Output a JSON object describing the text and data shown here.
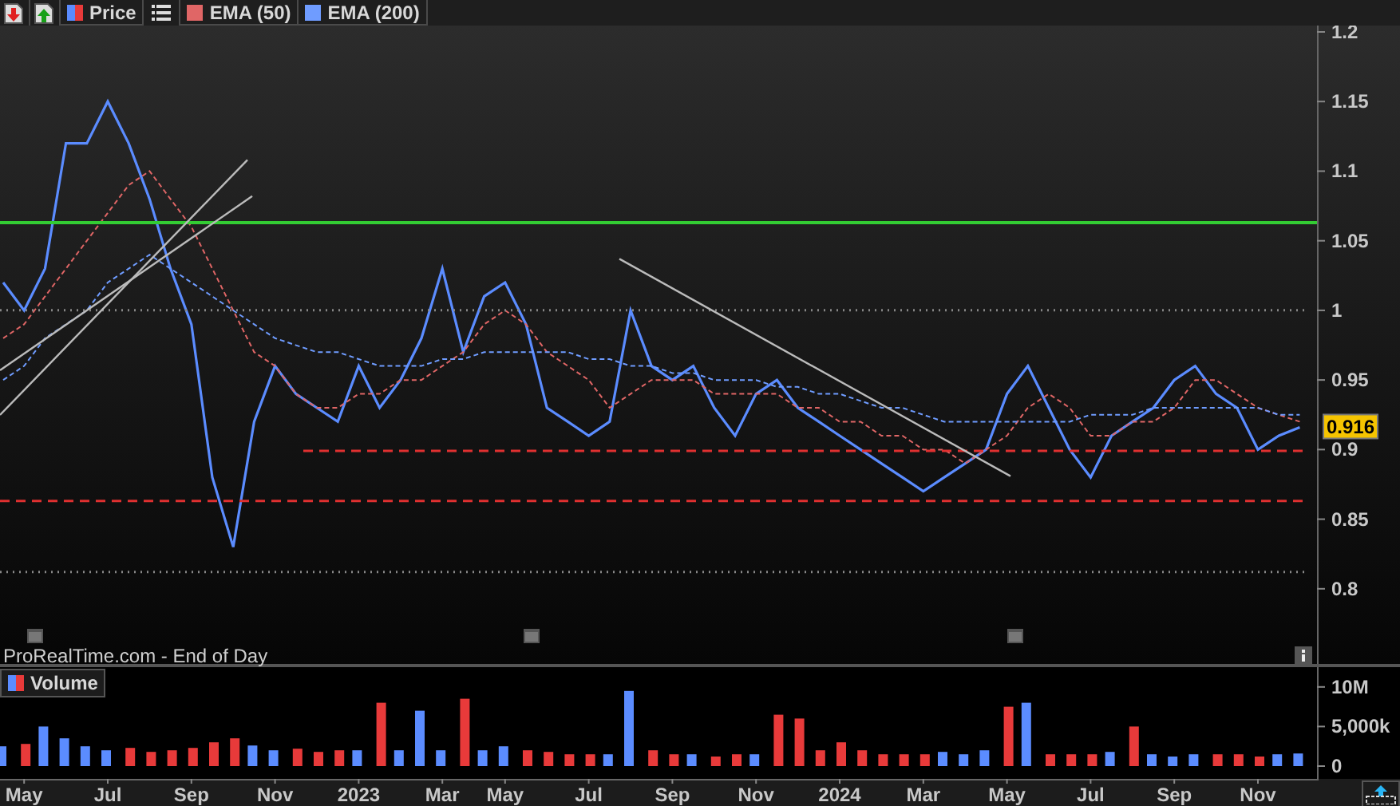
{
  "price_panel": {
    "source_label": "ProRealTime.com - End of Day",
    "chart_data": {
      "type": "line",
      "categories": [
        null,
        null,
        null,
        null,
        null,
        null,
        null,
        null,
        null,
        null,
        null,
        null,
        null,
        null,
        null,
        null,
        null,
        null,
        null,
        null,
        null,
        null,
        null,
        null,
        null,
        null,
        null,
        null,
        null,
        null,
        null,
        null,
        null,
        null,
        null,
        null,
        null,
        null,
        null,
        null,
        null,
        null,
        null,
        null,
        null,
        null,
        null,
        null,
        null,
        null,
        null,
        null,
        null,
        null,
        null,
        null,
        null,
        null,
        null,
        null,
        null,
        null,
        null
      ],
      "series": [
        {
          "name": "Price",
          "color": "#5b8cff",
          "values": [
            1.02,
            1.0,
            1.03,
            1.12,
            1.12,
            1.15,
            1.12,
            1.08,
            1.03,
            0.99,
            0.88,
            0.83,
            0.92,
            0.96,
            0.94,
            0.93,
            0.92,
            0.96,
            0.93,
            0.95,
            0.98,
            1.03,
            0.97,
            1.01,
            1.02,
            0.99,
            0.93,
            0.92,
            0.91,
            0.92,
            1.0,
            0.96,
            0.95,
            0.96,
            0.93,
            0.91,
            0.94,
            0.95,
            0.93,
            0.92,
            0.91,
            0.9,
            0.89,
            0.88,
            0.87,
            0.88,
            0.89,
            0.9,
            0.94,
            0.96,
            0.93,
            0.9,
            0.88,
            0.91,
            0.92,
            0.93,
            0.95,
            0.96,
            0.94,
            0.93,
            0.9,
            0.91,
            0.916
          ]
        },
        {
          "name": "EMA (50)",
          "color": "#e06666",
          "line_style": "dashed",
          "values": [
            0.98,
            0.99,
            1.01,
            1.03,
            1.05,
            1.07,
            1.09,
            1.1,
            1.08,
            1.06,
            1.03,
            1.0,
            0.97,
            0.96,
            0.94,
            0.93,
            0.93,
            0.94,
            0.94,
            0.95,
            0.95,
            0.96,
            0.97,
            0.99,
            1.0,
            0.99,
            0.97,
            0.96,
            0.95,
            0.93,
            0.94,
            0.95,
            0.95,
            0.95,
            0.94,
            0.94,
            0.94,
            0.94,
            0.93,
            0.93,
            0.92,
            0.92,
            0.91,
            0.91,
            0.9,
            0.9,
            0.89,
            0.9,
            0.91,
            0.93,
            0.94,
            0.93,
            0.91,
            0.91,
            0.92,
            0.92,
            0.93,
            0.95,
            0.95,
            0.94,
            0.93,
            0.925,
            0.92
          ]
        },
        {
          "name": "EMA (200)",
          "color": "#6f9cff",
          "line_style": "dashed",
          "values": [
            0.95,
            0.96,
            0.98,
            0.99,
            1.0,
            1.02,
            1.03,
            1.04,
            1.03,
            1.02,
            1.01,
            1.0,
            0.99,
            0.98,
            0.975,
            0.97,
            0.97,
            0.965,
            0.96,
            0.96,
            0.96,
            0.965,
            0.965,
            0.97,
            0.97,
            0.97,
            0.97,
            0.97,
            0.965,
            0.965,
            0.96,
            0.96,
            0.955,
            0.955,
            0.95,
            0.95,
            0.95,
            0.945,
            0.945,
            0.94,
            0.94,
            0.935,
            0.93,
            0.93,
            0.925,
            0.92,
            0.92,
            0.92,
            0.92,
            0.92,
            0.92,
            0.92,
            0.925,
            0.925,
            0.925,
            0.93,
            0.93,
            0.93,
            0.93,
            0.93,
            0.93,
            0.925,
            0.925
          ]
        }
      ],
      "ylim": [
        0.746,
        1.2046
      ],
      "yticks": [
        0.8,
        0.85,
        0.9,
        0.95,
        1,
        1.05,
        1.1,
        1.15,
        1.2
      ],
      "annotations": [
        "0.916"
      ]
    }
  },
  "volume_panel": {
    "chart_data": {
      "type": "bar",
      "title": "Volume",
      "stacked": false,
      "categories": [
        null,
        "May",
        null,
        null,
        null,
        "Jul",
        null,
        null,
        null,
        "Sep",
        null,
        null,
        null,
        "Nov",
        null,
        null,
        null,
        "2023",
        null,
        null,
        null,
        "Mar",
        null,
        null,
        "May",
        null,
        null,
        null,
        "Jul",
        null,
        null,
        null,
        "Sep",
        null,
        null,
        null,
        "Nov",
        null,
        null,
        null,
        "2024",
        null,
        null,
        null,
        "Mar",
        null,
        null,
        null,
        "May",
        null,
        null,
        null,
        "Jul",
        null,
        null,
        null,
        "Sep",
        null,
        null,
        null,
        "Nov",
        null,
        null
      ],
      "series": [
        {
          "color": "#5b8cff",
          "values": [
            2500000,
            null,
            5000000,
            3500000,
            2500000,
            2000000,
            null,
            null,
            null,
            null,
            null,
            null,
            2600000,
            2000000,
            null,
            null,
            null,
            2000000,
            null,
            2000000,
            7000000,
            2000000,
            null,
            2000000,
            2500000,
            null,
            null,
            null,
            null,
            1500000,
            9500000,
            null,
            null,
            1500000,
            null,
            null,
            1500000,
            null,
            null,
            null,
            null,
            null,
            null,
            null,
            null,
            1800000,
            1500000,
            2000000,
            null,
            8000000,
            null,
            null,
            null,
            1800000,
            null,
            1500000,
            1200000,
            1500000,
            null,
            null,
            null,
            1500000,
            1600000
          ]
        },
        {
          "color": "#e83a3a",
          "values": [
            null,
            2800000,
            null,
            null,
            null,
            null,
            2300000,
            1800000,
            2000000,
            2300000,
            3000000,
            3500000,
            null,
            null,
            2200000,
            1800000,
            2000000,
            null,
            8000000,
            null,
            null,
            null,
            8500000,
            null,
            null,
            2000000,
            1800000,
            1500000,
            1500000,
            null,
            null,
            2000000,
            1500000,
            null,
            1200000,
            1500000,
            null,
            6500000,
            6000000,
            2000000,
            3000000,
            2000000,
            1500000,
            1500000,
            1500000,
            null,
            null,
            null,
            7500000,
            null,
            1500000,
            1500000,
            1500000,
            null,
            5000000,
            null,
            null,
            null,
            1500000,
            1500000,
            1200000,
            null,
            null
          ]
        }
      ],
      "ylim": [
        0,
        12500000
      ],
      "yticks": [
        {
          "value": 0,
          "label": "0"
        },
        {
          "value": 5000000,
          "label": "5,000k"
        },
        {
          "value": 10000000,
          "label": "10M"
        }
      ]
    }
  }
}
